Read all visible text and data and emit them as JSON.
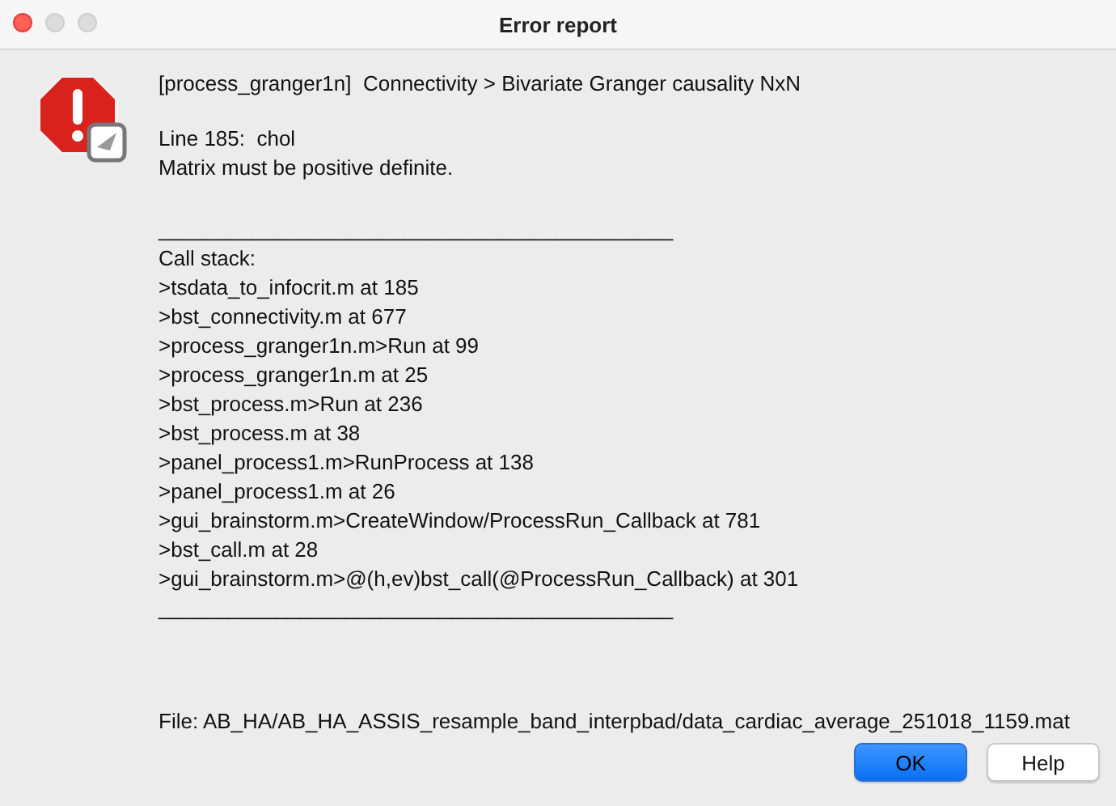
{
  "window": {
    "title": "Error report"
  },
  "message": {
    "header": "[process_granger1n]  Connectivity > Bivariate Granger causality NxN",
    "error_lines": [
      "Line 185:  chol",
      "Matrix must be positive definite."
    ],
    "separator_top": "____________________________________________",
    "call_stack_title": "Call stack:",
    "call_stack": [
      ">tsdata_to_infocrit.m at 185",
      ">bst_connectivity.m at 677",
      ">process_granger1n.m>Run at 99",
      ">process_granger1n.m at 25",
      ">bst_process.m>Run at 236",
      ">bst_process.m at 38",
      ">panel_process1.m>RunProcess at 138",
      ">panel_process1.m at 26",
      ">gui_brainstorm.m>CreateWindow/ProcessRun_Callback at 781",
      ">bst_call.m at 28",
      ">gui_brainstorm.m>@(h,ev)bst_call(@ProcessRun_Callback) at 301"
    ],
    "separator_bottom": "____________________________________________",
    "file": "File: AB_HA/AB_HA_ASSIS_resample_band_interpbad/data_cardiac_average_251018_1159.mat"
  },
  "buttons": [
    {
      "label": "OK",
      "default": true
    },
    {
      "label": "Help",
      "default": false
    }
  ]
}
